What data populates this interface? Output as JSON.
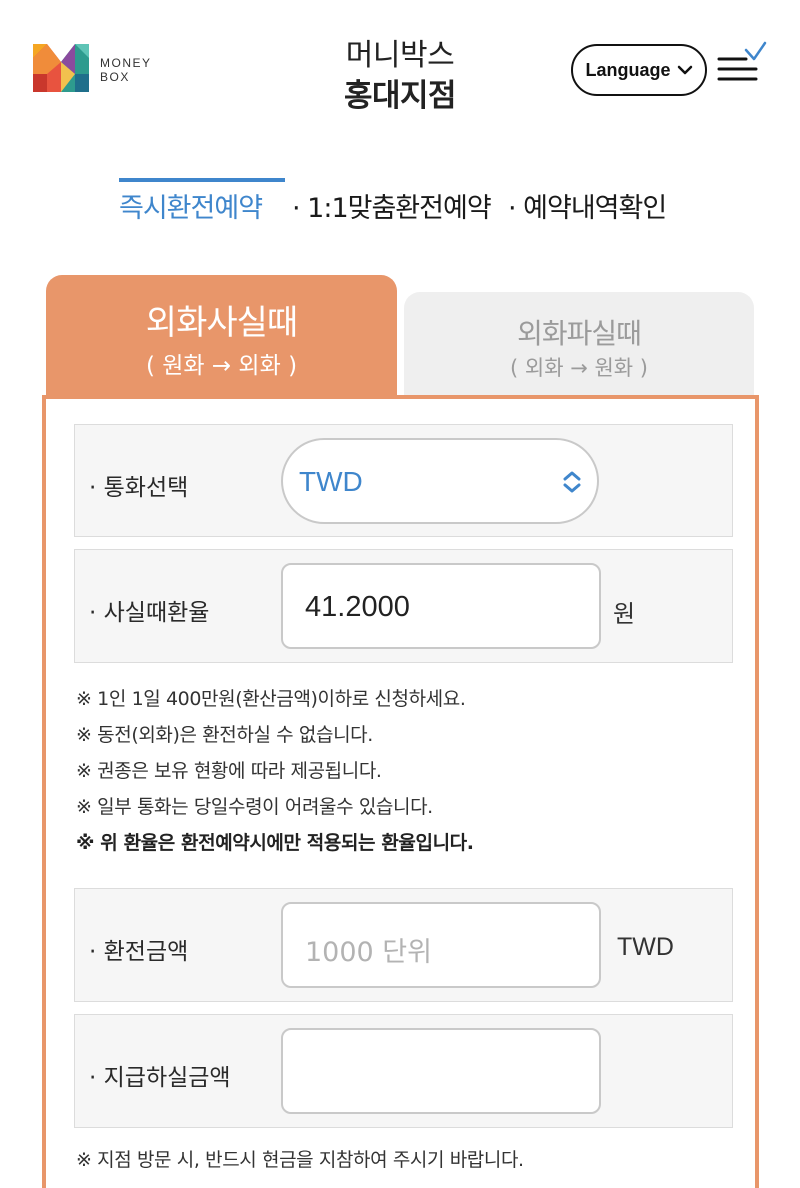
{
  "header": {
    "logo_text_line1": "MONEY",
    "logo_text_line2": "BOX",
    "branch_line1": "머니박스",
    "branch_line2": "홍대지점",
    "language_label": "Language"
  },
  "subnav": {
    "items": [
      "즉시환전예약",
      "· 1:1맞춤환전예약",
      "· 예약내역확인"
    ]
  },
  "tabs": [
    {
      "title": "외화사실때",
      "subtitle": "( 원화 → 외화 )"
    },
    {
      "title": "외화파실때",
      "subtitle": "( 외화 → 원화 )"
    }
  ],
  "form": {
    "currency_label": "· 통화선택",
    "currency_value": "TWD",
    "rate_label": "· 사실때환율",
    "rate_value": "41.2000",
    "rate_unit": "원",
    "amount_label": "· 환전금액",
    "amount_placeholder": "1000 단위",
    "amount_unit": "TWD",
    "pay_label": "· 지급하실금액",
    "pay_value": ""
  },
  "notices": [
    "※ 1인 1일 400만원(환산금액)이하로 신청하세요.",
    "※ 동전(외화)은 환전하실 수 없습니다.",
    "※ 권종은 보유 현황에 따라 제공됩니다.",
    "※ 일부 통화는 당일수령이 어려울수 있습니다.",
    "※ 위 환율은 환전예약시에만 적용되는 환율입니다."
  ],
  "bottom_notice": "※ 지점 방문 시, 반드시 현금을 지참하여 주시기 바랍니다.",
  "colors": {
    "accent_orange": "#e8966a",
    "accent_blue": "#3f86cc"
  }
}
